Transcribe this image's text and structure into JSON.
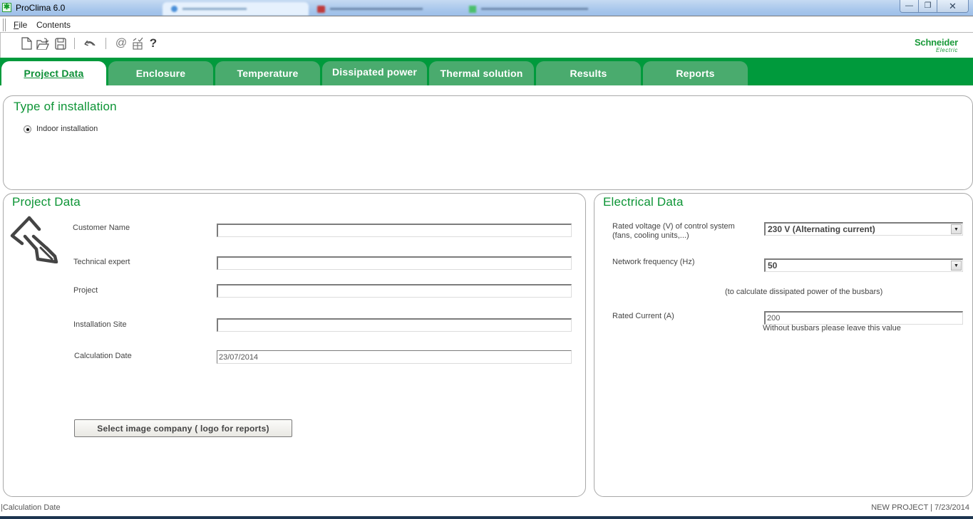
{
  "window": {
    "title": "ProClima 6.0",
    "app_icon": "proclima-app-icon",
    "controls": {
      "minimize": "—",
      "restore": "❐",
      "close": "✕"
    }
  },
  "menu": {
    "items": [
      {
        "label": "File",
        "accesskey": "F"
      },
      {
        "label": "Contents"
      }
    ]
  },
  "toolbar": {
    "icons": [
      "new-file-icon",
      "open-folder-icon",
      "save-icon",
      "undo-icon",
      "email-icon",
      "checklist-icon",
      "help-icon"
    ],
    "help_glyph": "?",
    "email_glyph": "@"
  },
  "brand": {
    "line1": "Schneider",
    "line2": "Electric",
    "color": "#1a9a3a"
  },
  "tabs": [
    {
      "label": "Project Data",
      "active": true
    },
    {
      "label": "Enclosure",
      "active": false
    },
    {
      "label": "Temperature",
      "active": false
    },
    {
      "label": "Dissipated power",
      "active": false
    },
    {
      "label": "Thermal solution",
      "active": false
    },
    {
      "label": "Results",
      "active": false
    },
    {
      "label": "Reports",
      "active": false
    }
  ],
  "type_of_installation": {
    "title": "Type of installation",
    "options": [
      {
        "label": "Indoor installation",
        "selected": true
      }
    ]
  },
  "project_data": {
    "title": "Project Data",
    "icon": "pen-nib-icon",
    "fields": [
      {
        "label": "Customer Name",
        "value": ""
      },
      {
        "label": "Technical expert",
        "value": ""
      },
      {
        "label": "Project",
        "value": ""
      },
      {
        "label": "Installation Site",
        "value": ""
      },
      {
        "label": "Calculation Date",
        "value": "23/07/2014"
      }
    ],
    "logo_button": "Select image company ( logo for reports)"
  },
  "electrical_data": {
    "title": "Electrical Data",
    "rated_voltage": {
      "label": "Rated voltage (V) of control system (fans, cooling units,...)",
      "value": "230 V (Alternating current)"
    },
    "network_frequency": {
      "label": "Network frequency (Hz)",
      "value": "50"
    },
    "busbar_note": "(to calculate dissipated power of the busbars)",
    "rated_current": {
      "label": "Rated Current (A)",
      "value": "200",
      "hint": "Without busbars please leave this value"
    }
  },
  "status": {
    "left": "|Calculation Date",
    "right": "NEW PROJECT | 7/23/2014"
  },
  "colors": {
    "accent_green": "#009a3c",
    "tab_inactive": "#4aab6e",
    "title_green": "#0c9435"
  }
}
